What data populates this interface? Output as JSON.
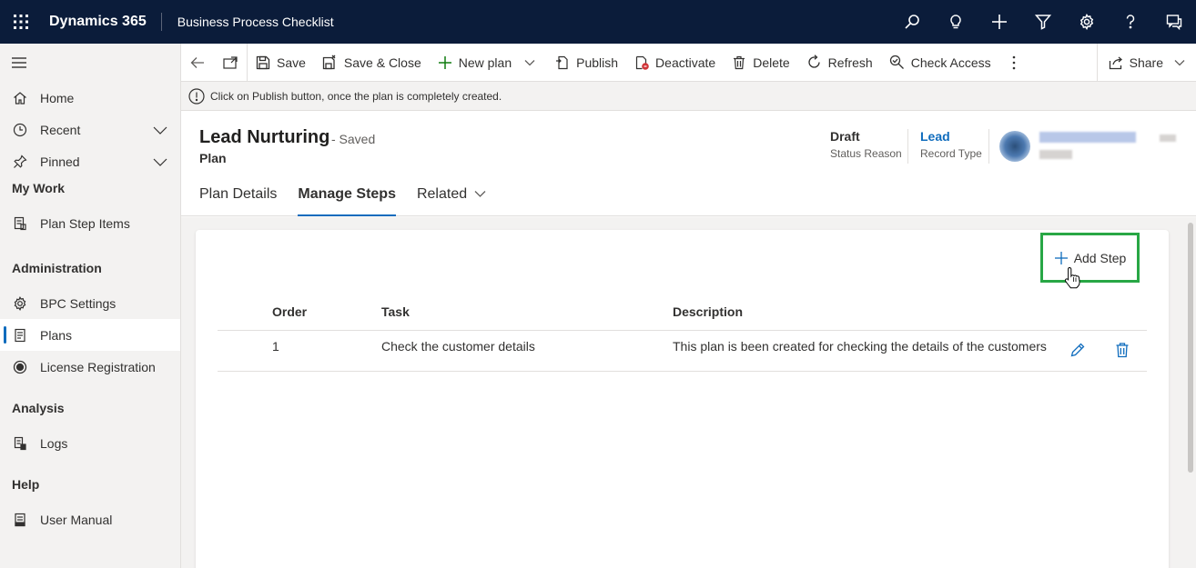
{
  "topbar": {
    "brand": "Dynamics 365",
    "app_name": "Business Process Checklist",
    "icons": [
      "waffle-icon",
      "search-icon",
      "lightbulb-icon",
      "plus-icon",
      "filter-icon",
      "gear-icon",
      "help-icon",
      "feedback-icon"
    ]
  },
  "sidebar": {
    "home": "Home",
    "recent": "Recent",
    "pinned": "Pinned",
    "sections": {
      "my_work": "My Work",
      "administration": "Administration",
      "analysis": "Analysis",
      "help": "Help"
    },
    "items": {
      "plan_step_items": "Plan Step Items",
      "bpc_settings": "BPC Settings",
      "plans": "Plans",
      "license_registration": "License Registration",
      "logs": "Logs",
      "user_manual": "User Manual"
    }
  },
  "commandbar": {
    "save": "Save",
    "save_close": "Save & Close",
    "new_plan": "New plan",
    "publish": "Publish",
    "deactivate": "Deactivate",
    "delete": "Delete",
    "refresh": "Refresh",
    "check_access": "Check Access",
    "share": "Share"
  },
  "notification": "Click on Publish button, once the plan is completely created.",
  "header": {
    "title": "Lead Nurturing",
    "saved_status": "- Saved",
    "entity": "Plan",
    "status_reason_value": "Draft",
    "status_reason_label": "Status Reason",
    "record_type_value": "Lead",
    "record_type_label": "Record Type"
  },
  "tabs": {
    "plan_details": "Plan Details",
    "manage_steps": "Manage Steps",
    "related": "Related"
  },
  "steps": {
    "add_step": "Add Step",
    "columns": {
      "order": "Order",
      "task": "Task",
      "description": "Description"
    },
    "rows": [
      {
        "order": "1",
        "task": "Check the customer details",
        "description": "This plan is been created for checking the details of the customers"
      }
    ]
  },
  "colors": {
    "topbar": "#0b1c3a",
    "accent": "#0f6cbd",
    "highlight_border": "#28a745"
  }
}
